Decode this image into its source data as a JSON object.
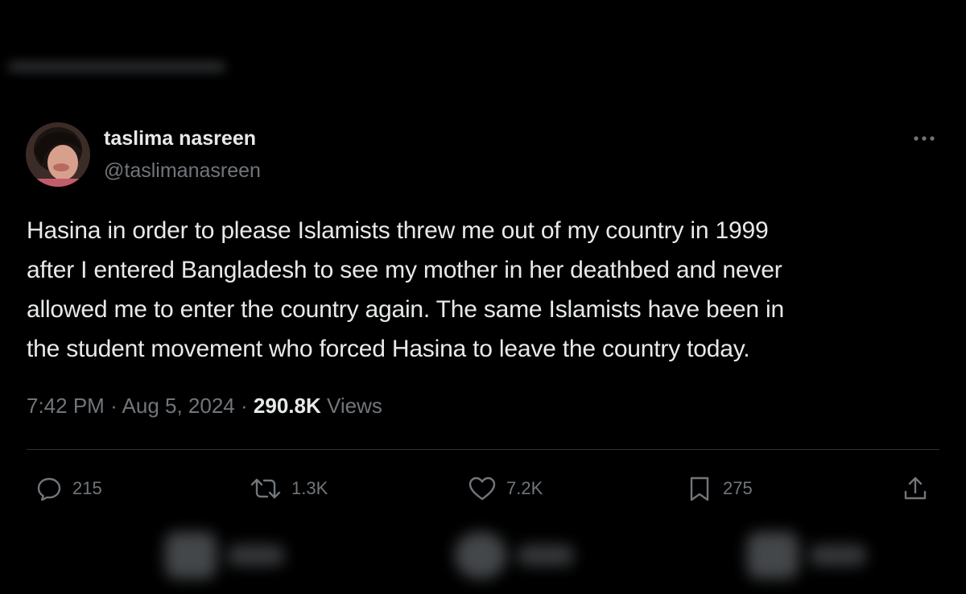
{
  "author": {
    "display_name": "taslima nasreen",
    "handle": "@taslimanasreen"
  },
  "tweet": {
    "text": "Hasina in order to please Islamists threw me out of my country in 1999\nafter I entered Bangladesh to see my mother in her deathbed and never\nallowed me to enter the country again. The same Islamists have been in\nthe student movement who forced Hasina to leave the country today."
  },
  "meta": {
    "time": "7:42 PM",
    "separator": "·",
    "date": "Aug 5, 2024",
    "views_count": "290.8K",
    "views_label": "Views"
  },
  "actions": {
    "reply": {
      "icon": "reply-icon",
      "count": "215"
    },
    "retweet": {
      "icon": "retweet-icon",
      "count": "1.3K"
    },
    "like": {
      "icon": "heart-icon",
      "count": "7.2K"
    },
    "bookmark": {
      "icon": "bookmark-icon",
      "count": "275"
    },
    "share": {
      "icon": "share-icon"
    }
  },
  "colors": {
    "background": "#000000",
    "primary_text": "#e7e9ea",
    "secondary_text": "#71767b",
    "divider": "#2f3336"
  }
}
